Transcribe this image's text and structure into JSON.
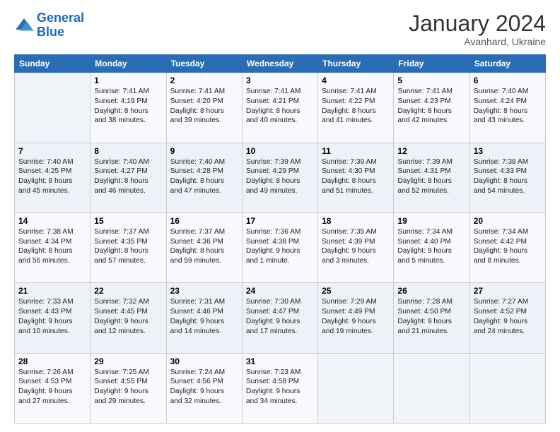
{
  "header": {
    "logo_line1": "General",
    "logo_line2": "Blue",
    "month": "January 2024",
    "location": "Avanhard, Ukraine"
  },
  "weekdays": [
    "Sunday",
    "Monday",
    "Tuesday",
    "Wednesday",
    "Thursday",
    "Friday",
    "Saturday"
  ],
  "weeks": [
    [
      {
        "day": "",
        "info": ""
      },
      {
        "day": "1",
        "info": "Sunrise: 7:41 AM\nSunset: 4:19 PM\nDaylight: 8 hours\nand 38 minutes."
      },
      {
        "day": "2",
        "info": "Sunrise: 7:41 AM\nSunset: 4:20 PM\nDaylight: 8 hours\nand 39 minutes."
      },
      {
        "day": "3",
        "info": "Sunrise: 7:41 AM\nSunset: 4:21 PM\nDaylight: 8 hours\nand 40 minutes."
      },
      {
        "day": "4",
        "info": "Sunrise: 7:41 AM\nSunset: 4:22 PM\nDaylight: 8 hours\nand 41 minutes."
      },
      {
        "day": "5",
        "info": "Sunrise: 7:41 AM\nSunset: 4:23 PM\nDaylight: 8 hours\nand 42 minutes."
      },
      {
        "day": "6",
        "info": "Sunrise: 7:40 AM\nSunset: 4:24 PM\nDaylight: 8 hours\nand 43 minutes."
      }
    ],
    [
      {
        "day": "7",
        "info": "Sunrise: 7:40 AM\nSunset: 4:25 PM\nDaylight: 8 hours\nand 45 minutes."
      },
      {
        "day": "8",
        "info": "Sunrise: 7:40 AM\nSunset: 4:27 PM\nDaylight: 8 hours\nand 46 minutes."
      },
      {
        "day": "9",
        "info": "Sunrise: 7:40 AM\nSunset: 4:28 PM\nDaylight: 8 hours\nand 47 minutes."
      },
      {
        "day": "10",
        "info": "Sunrise: 7:39 AM\nSunset: 4:29 PM\nDaylight: 8 hours\nand 49 minutes."
      },
      {
        "day": "11",
        "info": "Sunrise: 7:39 AM\nSunset: 4:30 PM\nDaylight: 8 hours\nand 51 minutes."
      },
      {
        "day": "12",
        "info": "Sunrise: 7:39 AM\nSunset: 4:31 PM\nDaylight: 8 hours\nand 52 minutes."
      },
      {
        "day": "13",
        "info": "Sunrise: 7:38 AM\nSunset: 4:33 PM\nDaylight: 8 hours\nand 54 minutes."
      }
    ],
    [
      {
        "day": "14",
        "info": "Sunrise: 7:38 AM\nSunset: 4:34 PM\nDaylight: 8 hours\nand 56 minutes."
      },
      {
        "day": "15",
        "info": "Sunrise: 7:37 AM\nSunset: 4:35 PM\nDaylight: 8 hours\nand 57 minutes."
      },
      {
        "day": "16",
        "info": "Sunrise: 7:37 AM\nSunset: 4:36 PM\nDaylight: 8 hours\nand 59 minutes."
      },
      {
        "day": "17",
        "info": "Sunrise: 7:36 AM\nSunset: 4:38 PM\nDaylight: 9 hours\nand 1 minute."
      },
      {
        "day": "18",
        "info": "Sunrise: 7:35 AM\nSunset: 4:39 PM\nDaylight: 9 hours\nand 3 minutes."
      },
      {
        "day": "19",
        "info": "Sunrise: 7:34 AM\nSunset: 4:40 PM\nDaylight: 9 hours\nand 5 minutes."
      },
      {
        "day": "20",
        "info": "Sunrise: 7:34 AM\nSunset: 4:42 PM\nDaylight: 9 hours\nand 8 minutes."
      }
    ],
    [
      {
        "day": "21",
        "info": "Sunrise: 7:33 AM\nSunset: 4:43 PM\nDaylight: 9 hours\nand 10 minutes."
      },
      {
        "day": "22",
        "info": "Sunrise: 7:32 AM\nSunset: 4:45 PM\nDaylight: 9 hours\nand 12 minutes."
      },
      {
        "day": "23",
        "info": "Sunrise: 7:31 AM\nSunset: 4:46 PM\nDaylight: 9 hours\nand 14 minutes."
      },
      {
        "day": "24",
        "info": "Sunrise: 7:30 AM\nSunset: 4:47 PM\nDaylight: 9 hours\nand 17 minutes."
      },
      {
        "day": "25",
        "info": "Sunrise: 7:29 AM\nSunset: 4:49 PM\nDaylight: 9 hours\nand 19 minutes."
      },
      {
        "day": "26",
        "info": "Sunrise: 7:28 AM\nSunset: 4:50 PM\nDaylight: 9 hours\nand 21 minutes."
      },
      {
        "day": "27",
        "info": "Sunrise: 7:27 AM\nSunset: 4:52 PM\nDaylight: 9 hours\nand 24 minutes."
      }
    ],
    [
      {
        "day": "28",
        "info": "Sunrise: 7:26 AM\nSunset: 4:53 PM\nDaylight: 9 hours\nand 27 minutes."
      },
      {
        "day": "29",
        "info": "Sunrise: 7:25 AM\nSunset: 4:55 PM\nDaylight: 9 hours\nand 29 minutes."
      },
      {
        "day": "30",
        "info": "Sunrise: 7:24 AM\nSunset: 4:56 PM\nDaylight: 9 hours\nand 32 minutes."
      },
      {
        "day": "31",
        "info": "Sunrise: 7:23 AM\nSunset: 4:58 PM\nDaylight: 9 hours\nand 34 minutes."
      },
      {
        "day": "",
        "info": ""
      },
      {
        "day": "",
        "info": ""
      },
      {
        "day": "",
        "info": ""
      }
    ]
  ]
}
